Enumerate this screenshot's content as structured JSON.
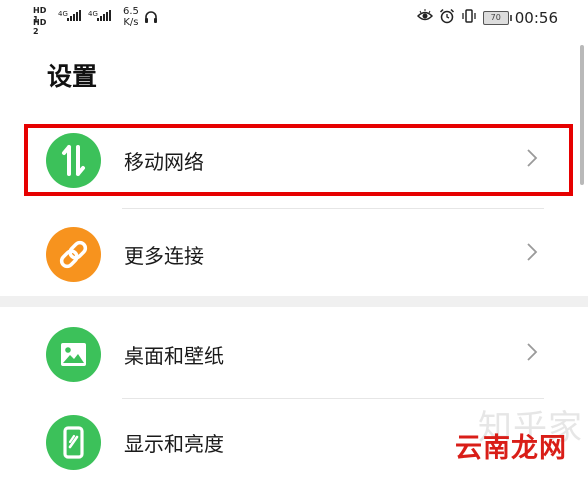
{
  "status_bar": {
    "hd1": "HD 1",
    "hd2": "HD 2",
    "signal1_label": "4G",
    "signal2_label": "4G",
    "speed_value": "6.5",
    "speed_unit": "K/s",
    "battery_level": "70",
    "time": "00:56",
    "icons": [
      "eye-icon",
      "alarm-icon",
      "vibrate-icon",
      "headset-icon"
    ]
  },
  "page": {
    "title": "设置"
  },
  "items": [
    {
      "label": "移动网络",
      "icon": "mobile-data-icon",
      "color": "#3cc15a"
    },
    {
      "label": "更多连接",
      "icon": "link-icon",
      "color": "#f7931e"
    },
    {
      "label": "桌面和壁纸",
      "icon": "image-icon",
      "color": "#3cc15a"
    },
    {
      "label": "显示和亮度",
      "icon": "phone-brightness-icon",
      "color": "#3cc15a"
    }
  ],
  "watermark": {
    "text": "云南龙网",
    "background_text": "知乎家"
  },
  "colors": {
    "highlight": "#e60000",
    "green": "#3cc15a",
    "orange": "#f7931e"
  }
}
